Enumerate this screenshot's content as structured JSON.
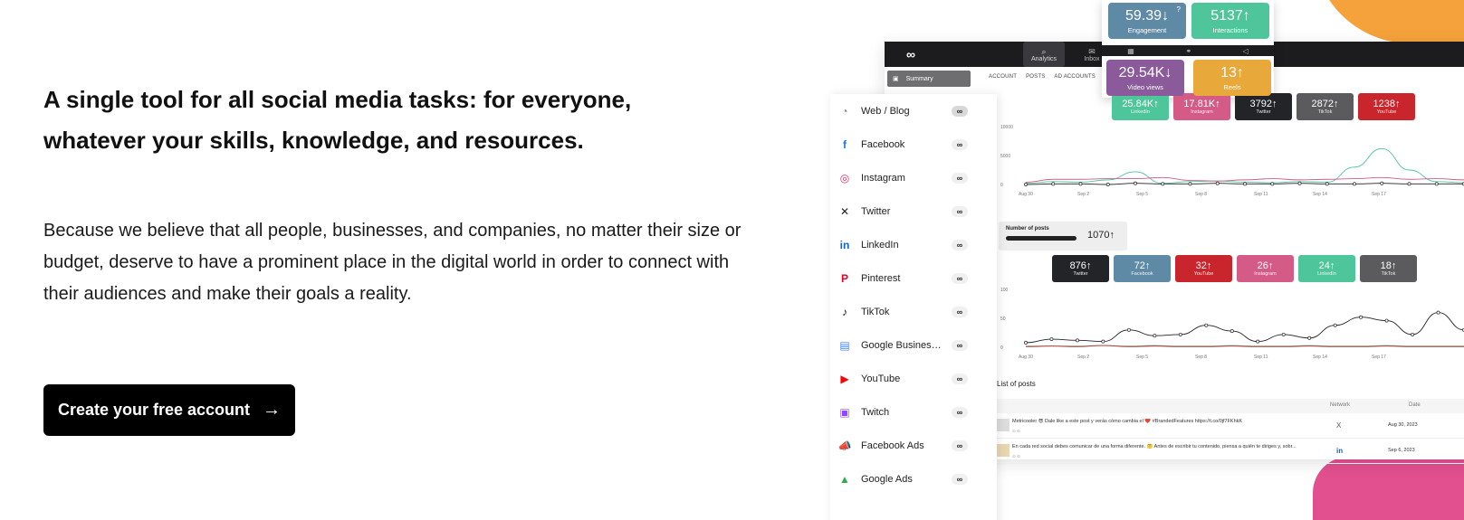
{
  "hero": {
    "headline": "A single tool for all social media tasks: for everyone, whatever your skills, knowledge, and resources.",
    "body": "Because we believe that all people, businesses, and companies, no matter their size or budget, deserve to have a prominent place in the digital world in order to connect with their audiences and make their goals a reality.",
    "cta_label": "Create your free account",
    "cta_arrow": "→"
  },
  "colors": {
    "cta_bg": "#000000",
    "accent_orange": "#f6a23c",
    "accent_pink": "#e2508f"
  },
  "app": {
    "logo": "∞",
    "nav": [
      {
        "label": "Analytics",
        "icon": "analytics-icon"
      },
      {
        "label": "Inbox",
        "icon": "inbox-icon"
      }
    ],
    "summary_label": "Summary",
    "subtabs": [
      "ACCOUNT",
      "POSTS",
      "AD ACCOUNTS"
    ],
    "overlay_tiles": [
      {
        "value": "59.39↓",
        "label": "Engagement",
        "color": "#5f8aa6",
        "help": "?"
      },
      {
        "value": "5137↑",
        "label": "Interactions",
        "color": "#4ec59a"
      },
      {
        "value": "29.54K↓",
        "label": "Video views",
        "color": "#8a5a9a"
      },
      {
        "value": "13↑",
        "label": "Reels",
        "color": "#e9a83a"
      }
    ],
    "audience_tiles": [
      {
        "value": "25.84K↑",
        "label": "LinkedIn",
        "color": "#4ec59a"
      },
      {
        "value": "17.81K↑",
        "label": "Instagram",
        "color": "#d35b86"
      },
      {
        "value": "3792↑",
        "label": "Twitter",
        "color": "#222428"
      },
      {
        "value": "2872↑",
        "label": "TikTok",
        "color": "#5b5b5e"
      },
      {
        "value": "1238↑",
        "label": "YouTube",
        "color": "#c8262c"
      }
    ],
    "chart1": {
      "y_ticks": [
        "10000",
        "5000",
        "0"
      ],
      "x_ticks": [
        "Aug 30",
        "Sep 2",
        "Sep 5",
        "Sep 8",
        "Sep 11",
        "Sep 14",
        "Sep 17"
      ]
    },
    "posts": {
      "label": "Number of posts",
      "value": "1070↑"
    },
    "posts_tiles": [
      {
        "value": "876↑",
        "label": "Twitter",
        "color": "#222428"
      },
      {
        "value": "72↑",
        "label": "Facebook",
        "color": "#5f8aa6"
      },
      {
        "value": "32↑",
        "label": "YouTube",
        "color": "#c8262c"
      },
      {
        "value": "26↑",
        "label": "Instagram",
        "color": "#d35b86"
      },
      {
        "value": "24↑",
        "label": "LinkedIn",
        "color": "#4ec59a"
      },
      {
        "value": "18↑",
        "label": "TikTok",
        "color": "#5b5b5e"
      }
    ],
    "chart2": {
      "y_ticks": [
        "100",
        "50",
        "0"
      ],
      "x_ticks": [
        "Aug 30",
        "Sep 2",
        "Sep 5",
        "Sep 8",
        "Sep 11",
        "Sep 14",
        "Sep 17"
      ]
    },
    "list": {
      "title": "List of posts",
      "col_network": "Network",
      "col_date": "Date",
      "rows": [
        {
          "text": "Metricooler 😎 Dale like a este post y verás cómo cambia el ❤️ #BrandedFeatures https://t.co/0jf7FKhkK",
          "network_icon": "x-icon",
          "net": "X",
          "date": "Aug 30, 2023"
        },
        {
          "text": "En cada red social debes comunicar de una forma diferente. 🤔 Antes de escribir tu contenido, piensa a quién te diriges y, sobr...",
          "network_icon": "linkedin-icon",
          "net": "in",
          "date": "Sep 6, 2023"
        }
      ]
    }
  },
  "networks": [
    {
      "label": "Web / Blog",
      "icon": "rss-icon",
      "glyph": "◔",
      "color": "#7a8da0"
    },
    {
      "label": "Facebook",
      "icon": "facebook-icon",
      "glyph": "f",
      "color": "#1877f2"
    },
    {
      "label": "Instagram",
      "icon": "instagram-icon",
      "glyph": "◎",
      "color": "#e1306c"
    },
    {
      "label": "Twitter",
      "icon": "x-icon",
      "glyph": "✕",
      "color": "#222222"
    },
    {
      "label": "LinkedIn",
      "icon": "linkedin-icon",
      "glyph": "in",
      "color": "#0a66c2"
    },
    {
      "label": "Pinterest",
      "icon": "pinterest-icon",
      "glyph": "P",
      "color": "#e60023"
    },
    {
      "label": "TikTok",
      "icon": "tiktok-icon",
      "glyph": "♪",
      "color": "#111111"
    },
    {
      "label": "Google Business ...",
      "icon": "google-business-icon",
      "glyph": "▤",
      "color": "#4285f4"
    },
    {
      "label": "YouTube",
      "icon": "youtube-icon",
      "glyph": "▶",
      "color": "#ff0000"
    },
    {
      "label": "Twitch",
      "icon": "twitch-icon",
      "glyph": "▣",
      "color": "#9146ff"
    },
    {
      "label": "Facebook Ads",
      "icon": "facebook-ads-icon",
      "glyph": "📣",
      "color": "#1877f2"
    },
    {
      "label": "Google Ads",
      "icon": "google-ads-icon",
      "glyph": "▲",
      "color": "#34a853"
    }
  ],
  "toggle_glyph": "∞"
}
